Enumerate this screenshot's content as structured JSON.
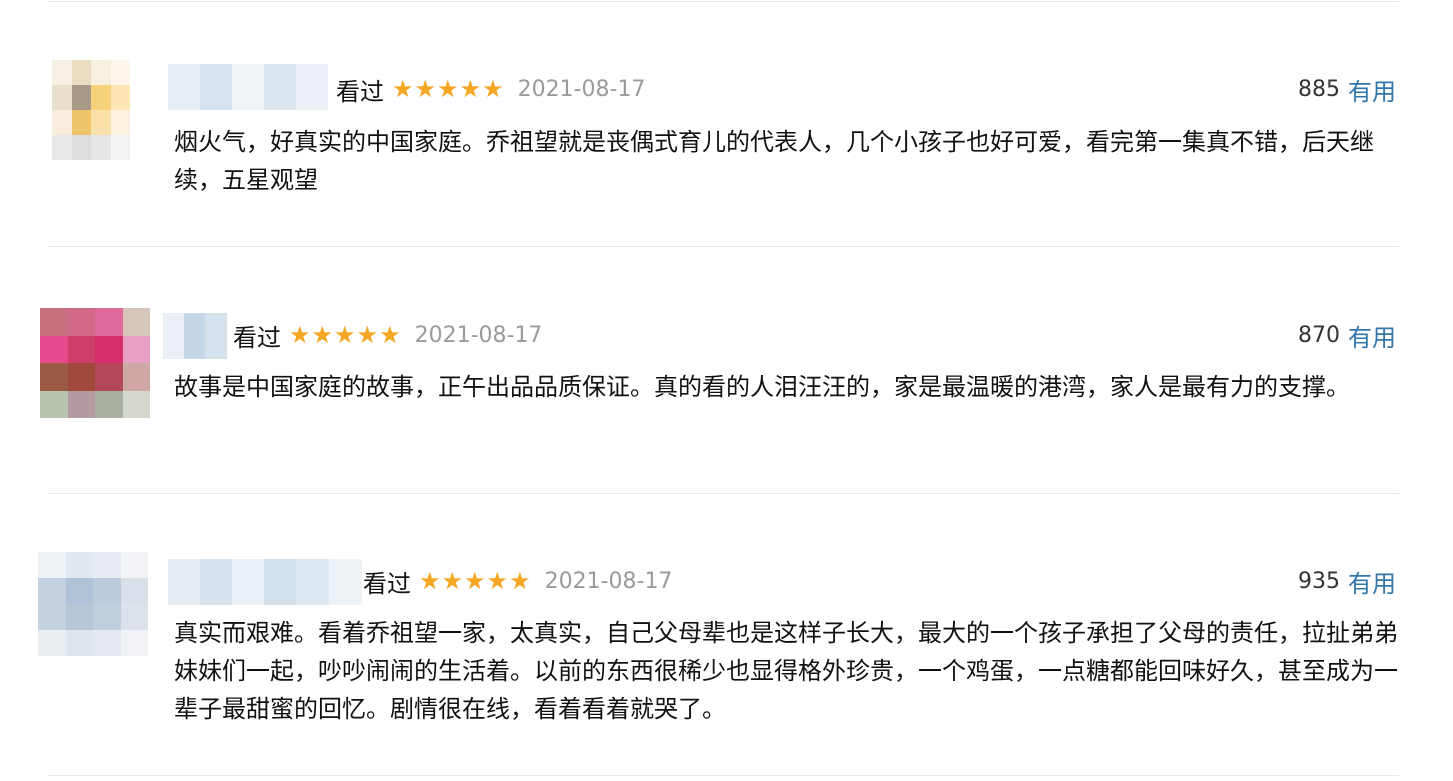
{
  "colors": {
    "star": "#f5a623",
    "link": "#3377aa",
    "date": "#9a9a9a",
    "divider": "#e8e8e8"
  },
  "reviews": [
    {
      "status": "看过",
      "rating_stars": 5,
      "date": "2021-08-17",
      "votes": "885",
      "useful_label": "有用",
      "text": "烟火气，好真实的中国家庭。乔祖望就是丧偶式育儿的代表人，几个小孩子也好可爱，看完第一集真不错，后天继续，五星观望"
    },
    {
      "status": "看过",
      "rating_stars": 5,
      "date": "2021-08-17",
      "votes": "870",
      "useful_label": "有用",
      "text": "故事是中国家庭的故事，正午出品品质保证。真的看的人泪汪汪的，家是最温暖的港湾，家人是最有力的支撑。"
    },
    {
      "status": "看过",
      "rating_stars": 5,
      "date": "2021-08-17",
      "votes": "935",
      "useful_label": "有用",
      "text": "真实而艰难。看着乔祖望一家，太真实，自己父母辈也是这样子长大，最大的一个孩子承担了父母的责任，拉扯弟弟妹妹们一起，吵吵闹闹的生活着。以前的东西很稀少也显得格外珍贵，一个鸡蛋，一点糖都能回味好久，甚至成为一辈子最甜蜜的回忆。剧情很在线，看着看着就哭了。"
    }
  ]
}
